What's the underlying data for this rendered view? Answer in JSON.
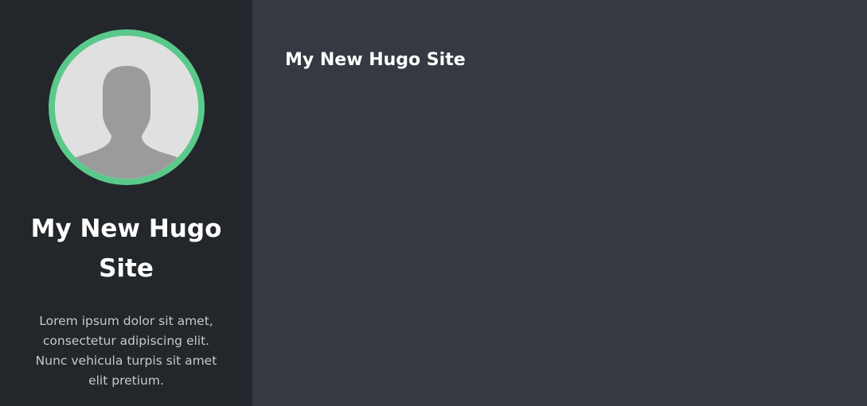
{
  "sidebar": {
    "site_title": "My New Hugo Site",
    "description": "Lorem ipsum dolor sit amet, consectetur adipiscing elit. Nunc vehicula turpis sit amet elit pretium.",
    "avatar_icon": "user-silhouette-icon"
  },
  "main": {
    "title": "My New Hugo Site"
  },
  "colors": {
    "sidebar_bg": "#23262b",
    "main_bg": "#353a42",
    "avatar_ring": "#5ac98b",
    "avatar_bg": "#e0e0e0",
    "silhouette": "#9b9b9b"
  }
}
